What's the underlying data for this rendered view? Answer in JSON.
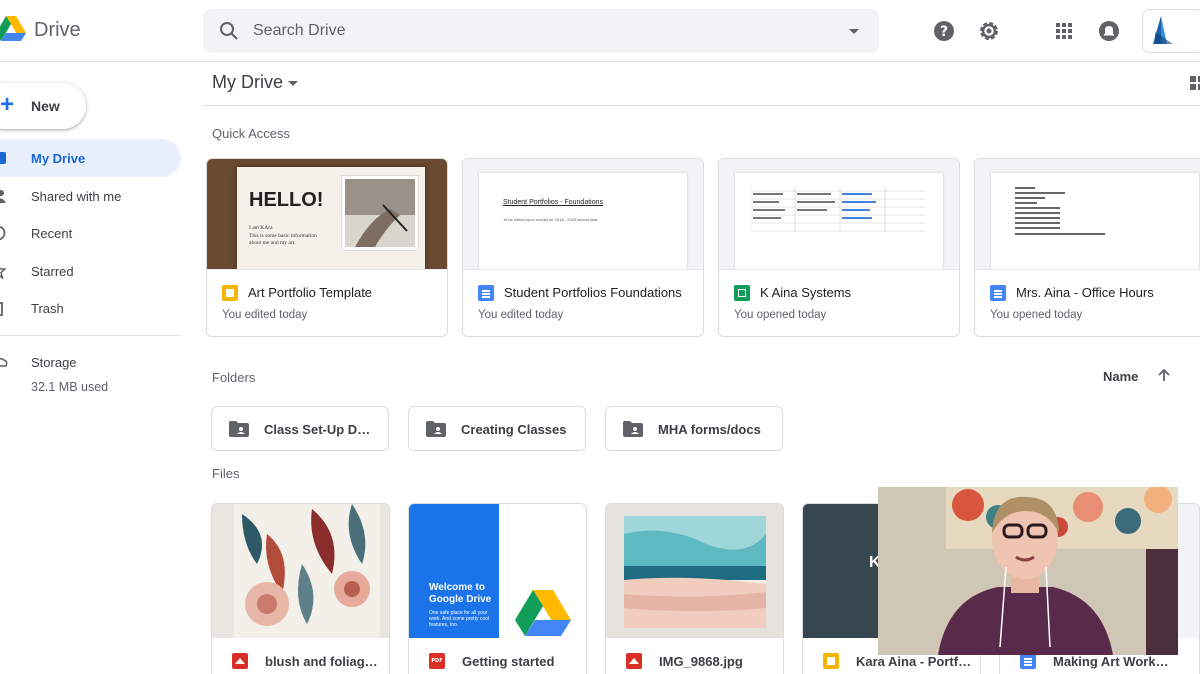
{
  "app": {
    "brand": "Drive"
  },
  "search": {
    "placeholder": "Search Drive"
  },
  "sidebar": {
    "new_label": "New",
    "items": [
      {
        "label": "My Drive",
        "icon": "my-drive-icon",
        "active": true
      },
      {
        "label": "Shared with me",
        "icon": "people-icon"
      },
      {
        "label": "Recent",
        "icon": "clock-icon"
      },
      {
        "label": "Starred",
        "icon": "star-icon"
      },
      {
        "label": "Trash",
        "icon": "trash-icon"
      }
    ],
    "storage": {
      "label": "Storage",
      "used": "32.1 MB used"
    }
  },
  "main": {
    "breadcrumb": "My Drive",
    "quick_access": {
      "heading": "Quick Access",
      "cards": [
        {
          "title": "Art Portfolio Template",
          "activity": "You edited today",
          "type": "slides",
          "thumb_heading": "HELLO!",
          "thumb_sub": "I am KAra",
          "thumb_text": "This is some basic information about me and my art."
        },
        {
          "title": "Student Portfolios Foundations",
          "activity": "You edited today",
          "type": "docs",
          "thumb_heading": "Student Portfolios - Foundations",
          "thumb_text": "To be edited upon receipt for 2018 - 2019 school year"
        },
        {
          "title": "K Aina Systems",
          "activity": "You opened today",
          "type": "sheets"
        },
        {
          "title": "Mrs. Aina - Office Hours",
          "activity": "You opened today",
          "type": "docs"
        }
      ]
    },
    "folders": {
      "heading": "Folders",
      "sort_label": "Name",
      "items": [
        {
          "label": "Class Set-Up Documents"
        },
        {
          "label": "Creating Classes"
        },
        {
          "label": "MHA forms/docs"
        }
      ]
    },
    "files": {
      "heading": "Files",
      "items": [
        {
          "label": "blush and foliage watercolor",
          "type": "image"
        },
        {
          "label": "Getting started",
          "type": "pdf",
          "thumb_title": "Welcome to Google Drive",
          "thumb_text": "One safe place for all your work. And some pretty cool features, too."
        },
        {
          "label": "IMG_9868.jpg",
          "type": "image"
        },
        {
          "label": "Kara Aina - Portfolio",
          "type": "slides",
          "thumb_text": "K"
        },
        {
          "label": "Making Art Work Digital",
          "type": "docs"
        }
      ]
    }
  },
  "colors": {
    "accent": "#1a73e8",
    "active_nav_bg": "#e8f0fe",
    "slides": "#f4b400",
    "docs": "#4285f4",
    "sheets": "#0f9d58",
    "image": "#d93025"
  }
}
